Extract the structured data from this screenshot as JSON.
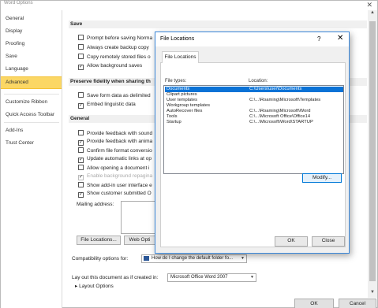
{
  "window": {
    "title": "Word Options",
    "close_glyph": "✕"
  },
  "sidebar": {
    "items": [
      {
        "label": "General"
      },
      {
        "label": "Display"
      },
      {
        "label": "Proofing"
      },
      {
        "label": "Save"
      },
      {
        "label": "Language"
      },
      {
        "label": "Advanced"
      },
      {
        "label": "Customize Ribbon"
      },
      {
        "label": "Quick Access Toolbar"
      },
      {
        "label": "Add-Ins"
      },
      {
        "label": "Trust Center"
      }
    ],
    "active": "Advanced"
  },
  "main": {
    "save_section": {
      "header": "Save",
      "options": [
        {
          "label": "Prompt before saving Norma",
          "checked": false
        },
        {
          "label": "Always create backup copy",
          "checked": false
        },
        {
          "label": "Copy remotely stored files o",
          "checked": false
        },
        {
          "label": "Allow background saves",
          "checked": true
        }
      ]
    },
    "fidelity_section": {
      "header": "Preserve fidelity when sharing th",
      "options": [
        {
          "label": "Save form data as delimited",
          "checked": false
        },
        {
          "label": "Embed linguistic data",
          "checked": true
        }
      ]
    },
    "general_section": {
      "header": "General",
      "options": [
        {
          "label": "Provide feedback with sound",
          "checked": false
        },
        {
          "label": "Provide feedback with anima",
          "checked": true
        },
        {
          "label": "Confirm file format conversio",
          "checked": false
        },
        {
          "label": "Update automatic links at op",
          "checked": true
        },
        {
          "label": "Allow opening a document i",
          "checked": false
        },
        {
          "label": "Enable background repagina",
          "checked": true,
          "disabled": true
        },
        {
          "label": "Show add-in user interface e",
          "checked": false
        },
        {
          "label": "Show customer submitted O",
          "checked": true
        }
      ],
      "mailing_address_label": "Mailing address:",
      "file_locations_button": "File Locations...",
      "web_options_button": "Web Opti"
    },
    "compat": {
      "label": "Compatibility options for:",
      "value": "How do I change the default folder fo..."
    },
    "layout": {
      "label": "Lay out this document as if created in:",
      "value": "Microsoft Office Word 2007",
      "expander": "Layout Options"
    }
  },
  "footer": {
    "ok": "OK",
    "cancel": "Cancel"
  },
  "dialog": {
    "title": "File Locations",
    "help": "?",
    "close": "✕",
    "tab": "File Locations",
    "col_file_types": "File types:",
    "col_location": "Location:",
    "rows": [
      {
        "type": "Documents",
        "location": "C:\\Users\\user\\Documents",
        "selected": true
      },
      {
        "type": "Clipart pictures",
        "location": "",
        "selected": false
      },
      {
        "type": "User templates",
        "location": "C:\\...\\Roaming\\Microsoft\\Templates",
        "selected": false
      },
      {
        "type": "Workgroup templates",
        "location": "",
        "selected": false
      },
      {
        "type": "AutoRecover files",
        "location": "C:\\...\\Roaming\\Microsoft\\Word",
        "selected": false
      },
      {
        "type": "Tools",
        "location": "C:\\...\\Microsoft Office\\Office14",
        "selected": false
      },
      {
        "type": "Startup",
        "location": "C:\\...\\Microsoft\\Word\\STARTUP",
        "selected": false
      }
    ],
    "modify_button": "Modify...",
    "ok_button": "OK",
    "close_button": "Close"
  },
  "colors": {
    "active_sidebar": "#fbd765",
    "selection": "#0a72d6",
    "dialog_border": "#3a86d8"
  }
}
